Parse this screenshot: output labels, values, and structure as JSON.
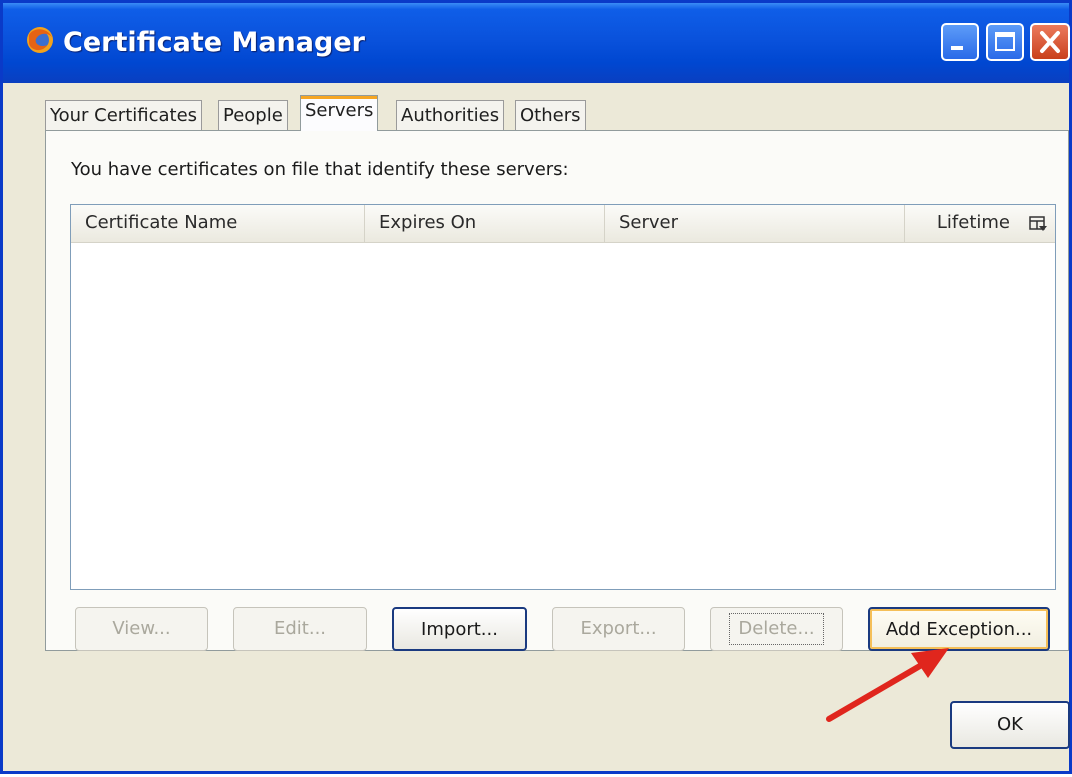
{
  "window": {
    "title": "Certificate Manager",
    "app_icon": "firefox-icon",
    "controls": [
      "minimize-icon",
      "maximize-icon",
      "close-icon"
    ]
  },
  "tabs": [
    {
      "label": "Your Certificates",
      "selected": false
    },
    {
      "label": "People",
      "selected": false
    },
    {
      "label": "Servers",
      "selected": true
    },
    {
      "label": "Authorities",
      "selected": false
    },
    {
      "label": "Others",
      "selected": false
    }
  ],
  "servers_panel": {
    "intro": "You have certificates on file that identify these servers:",
    "columns": [
      "Certificate Name",
      "Expires On",
      "Server",
      "Lifetime"
    ],
    "column_picker_icon": "column-picker-icon",
    "rows": []
  },
  "buttons": [
    {
      "label": "View...",
      "accesskey": "V",
      "enabled": false
    },
    {
      "label": "Edit...",
      "accesskey": "E",
      "enabled": false
    },
    {
      "label": "Import...",
      "accesskey": "m",
      "enabled": true
    },
    {
      "label": "Export...",
      "accesskey": "x",
      "enabled": false
    },
    {
      "label": "Delete...",
      "accesskey": "D",
      "enabled": false
    },
    {
      "label": "Add Exception...",
      "accesskey": "x",
      "enabled": true
    }
  ],
  "ok_button": {
    "label": "OK"
  },
  "annotation": {
    "type": "red-arrow",
    "points_to": "Add Exception..."
  },
  "colors": {
    "titlebar": "#0a52dc",
    "dialog_bg": "#ece9d8",
    "selected_tab_accent": "#f6a623",
    "annotation_arrow": "#e0261d"
  }
}
